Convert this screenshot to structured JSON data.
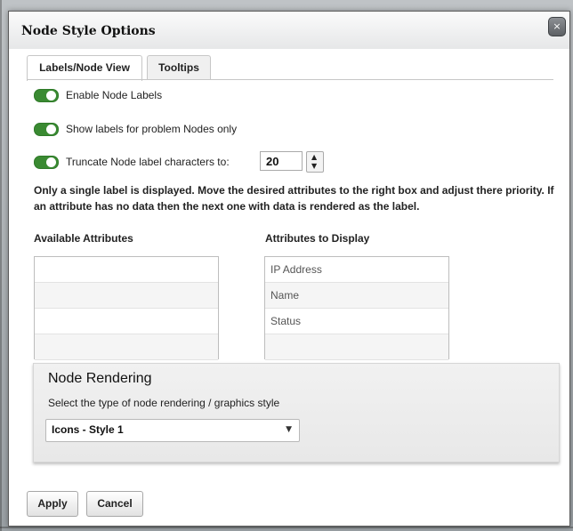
{
  "dialog": {
    "title": "Node Style Options",
    "close_glyph": "×"
  },
  "tabs": [
    {
      "label": "Labels/Node View",
      "active": true
    },
    {
      "label": "Tooltips",
      "active": false
    }
  ],
  "toggles": [
    {
      "label": "Enable Node Labels",
      "on": true
    },
    {
      "label": "Show labels for problem Nodes only",
      "on": true
    },
    {
      "label": "Truncate Node label characters to:",
      "on": true
    }
  ],
  "truncate_value": "20",
  "description": "Only a single label is displayed.  Move the desired attributes to the right box and adjust there priority.  If an attribute has no data then the next one with data is rendered as the label.",
  "available_attributes": {
    "label": "Available Attributes",
    "items": [
      "",
      "",
      "",
      ""
    ]
  },
  "attributes_to_display": {
    "label": "Attributes to Display",
    "items": [
      "IP Address",
      "Name",
      "Status",
      ""
    ]
  },
  "node_rendering": {
    "heading": "Node Rendering",
    "subtext": "Select the type of node rendering / graphics style",
    "selected": "Icons - Style 1"
  },
  "buttons": {
    "apply": "Apply",
    "cancel": "Cancel"
  },
  "colors": {
    "toggle_on": "#3a8a32",
    "title_bar": "#e6e7e8"
  }
}
